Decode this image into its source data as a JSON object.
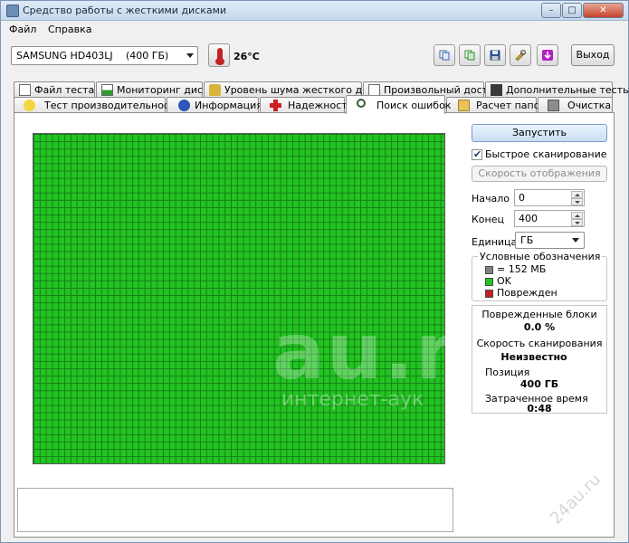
{
  "window": {
    "title": "Средство работы с жесткими дисками"
  },
  "menu": {
    "file": "Файл",
    "help": "Справка"
  },
  "toolbar": {
    "drive_name": "SAMSUNG HD403LJ",
    "drive_size": "(400 ГБ)",
    "temperature": "26°C",
    "exit_label": "Выход"
  },
  "tabs_top": [
    {
      "label": "Файл теста",
      "icon": "file-icon"
    },
    {
      "label": "Мониторинг диска",
      "icon": "chart-icon"
    },
    {
      "label": "Уровень шума жесткого диска",
      "icon": "speaker-icon"
    },
    {
      "label": "Произвольный доступ",
      "icon": "random-icon"
    },
    {
      "label": "Дополнительные тесты",
      "icon": "tests-icon"
    }
  ],
  "tabs_bottom": [
    {
      "label": "Тест производительности",
      "icon": "bulb-icon"
    },
    {
      "label": "Информация",
      "icon": "info-icon"
    },
    {
      "label": "Надежность",
      "icon": "cross-icon"
    },
    {
      "label": "Поиск ошибок",
      "icon": "magnifier-icon",
      "active": true
    },
    {
      "label": "Расчет папок",
      "icon": "folder-icon"
    },
    {
      "label": "Очистка",
      "icon": "trash-icon"
    }
  ],
  "scan": {
    "start_button": "Запустить",
    "quick_scan_label": "Быстрое сканирование",
    "quick_scan_checked": true,
    "display_speed_button": "Скорость отображения",
    "start_label": "Начало",
    "start_value": "0",
    "end_label": "Конец",
    "end_value": "400",
    "unit_label": "Единица",
    "unit_value": "ГБ"
  },
  "legend": {
    "title": "Условные обозначения",
    "block_size": "= 152 МБ",
    "ok": "OK",
    "damaged": "Поврежден",
    "colors": {
      "block": "#808080",
      "ok": "#22c422",
      "damaged": "#c42222"
    }
  },
  "stats": {
    "damaged_label": "Поврежденные блоки",
    "damaged_value": "0.0 %",
    "speed_label": "Скорость сканирования",
    "speed_value": "Неизвестно",
    "position_label": "Позиция",
    "position_value": "400 ГБ",
    "elapsed_label": "Затраченное время",
    "elapsed_value": "0:48"
  },
  "watermark": {
    "main": "au.r",
    "sub": "интернет-аук",
    "corner": "24au.ru"
  }
}
